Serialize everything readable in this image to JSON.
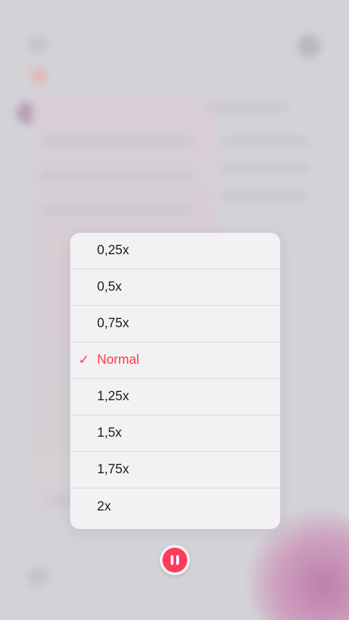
{
  "speed_menu": {
    "items": [
      {
        "label": "0,25x",
        "selected": false
      },
      {
        "label": "0,5x",
        "selected": false
      },
      {
        "label": "0,75x",
        "selected": false
      },
      {
        "label": "Normal",
        "selected": true
      },
      {
        "label": "1,25x",
        "selected": false
      },
      {
        "label": "1,5x",
        "selected": false
      },
      {
        "label": "1,75x",
        "selected": false
      },
      {
        "label": "2x",
        "selected": false
      }
    ],
    "check_glyph": "✓"
  },
  "player": {
    "pause_icon": "pause-icon"
  },
  "colors": {
    "accent": "#ff3b45",
    "pause_button": "#ff3b5c",
    "menu_background": "#f2f1f4"
  }
}
